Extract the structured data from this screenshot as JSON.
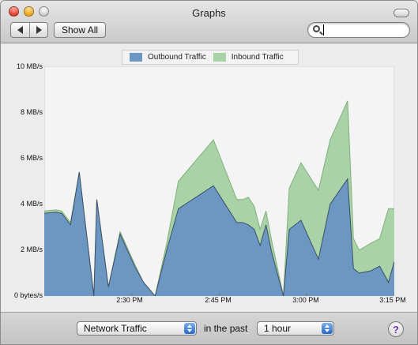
{
  "window": {
    "title": "Graphs"
  },
  "toolbar": {
    "show_all_label": "Show All",
    "search": {
      "value": "",
      "placeholder": ""
    }
  },
  "colors": {
    "outbound": "#6c97c2",
    "inbound": "#a9d3a7",
    "plot_background": "#f4f4f4"
  },
  "icons": {
    "back": "back-arrow-icon",
    "forward": "forward-arrow-icon",
    "search": "search-icon",
    "help": "help-icon"
  },
  "chart_data": {
    "type": "area",
    "title": "",
    "xlabel": "",
    "ylabel": "",
    "legend_position": "top-center",
    "grid": false,
    "y_ticks": [
      "0 bytes/s",
      "2 MB/s",
      "4 MB/s",
      "6 MB/s",
      "8 MB/s",
      "10 MB/s"
    ],
    "ylim": [
      0,
      10
    ],
    "x_ticks": [
      {
        "label": "2:30 PM",
        "minute": 15
      },
      {
        "label": "2:45 PM",
        "minute": 30
      },
      {
        "label": "3:00 PM",
        "minute": 45
      },
      {
        "label": "3:15 PM",
        "minute": 60
      }
    ],
    "xlim": [
      0,
      60
    ],
    "x": [
      0,
      2,
      3,
      4.5,
      6,
      8.5,
      9,
      11,
      13,
      15.5,
      17,
      19,
      21,
      23,
      29,
      33,
      34,
      35,
      36,
      37,
      38,
      39,
      41,
      42,
      44,
      47,
      49,
      52,
      53,
      54,
      56,
      57.5,
      59,
      60
    ],
    "series": [
      {
        "name": "Outbound Traffic",
        "values": [
          3.6,
          3.65,
          3.6,
          3.1,
          5.4,
          0.0,
          4.2,
          0.4,
          2.7,
          1.3,
          0.6,
          0.0,
          2.0,
          3.8,
          4.8,
          3.2,
          3.2,
          3.1,
          2.9,
          2.2,
          3.1,
          1.9,
          0.0,
          2.9,
          3.3,
          1.6,
          4.0,
          5.1,
          1.2,
          1.0,
          1.1,
          1.3,
          0.6,
          1.5
        ]
      },
      {
        "name": "Inbound Traffic",
        "values": [
          0.1,
          0.1,
          0.1,
          0.1,
          0.0,
          0.0,
          0.0,
          0.0,
          0.1,
          0.1,
          0.0,
          0.0,
          0.3,
          1.2,
          2.0,
          1.0,
          1.0,
          1.2,
          1.0,
          0.7,
          0.6,
          0.5,
          0.0,
          1.8,
          2.5,
          3.0,
          2.8,
          3.4,
          1.3,
          1.0,
          1.2,
          1.2,
          3.2,
          2.3
        ]
      }
    ]
  },
  "bottom": {
    "graph_select": "Network Traffic",
    "in_the_past": "in the past",
    "period_select": "1 hour",
    "help_label": "?"
  }
}
